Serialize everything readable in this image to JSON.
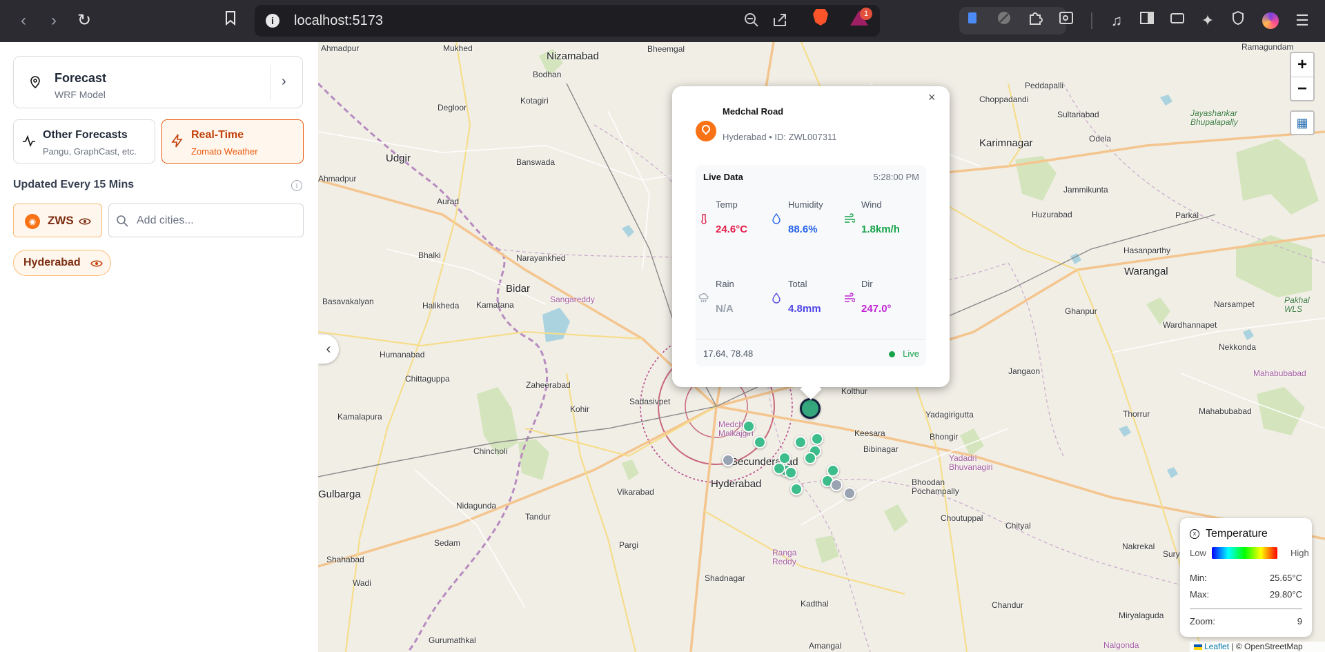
{
  "browser": {
    "url": "localhost:5173",
    "notification_count": "1"
  },
  "sidebar": {
    "forecast_card": {
      "title": "Forecast",
      "subtitle": "WRF Model"
    },
    "other_forecasts": {
      "title": "Other Forecasts",
      "subtitle": "Pangu, GraphCast, etc."
    },
    "realtime": {
      "title": "Real-Time",
      "subtitle": "Zomato Weather"
    },
    "updated_text": "Updated Every 15 Mins",
    "zws_label": "ZWS",
    "city_placeholder": "Add cities...",
    "city_chip": "Hyderabad",
    "accent_color": "#ea580c"
  },
  "map": {
    "places": [
      "Ahmadpur",
      "Mukhed",
      "Nizamabad",
      "Bheemgal",
      "Bodhan",
      "Degloor",
      "Kotagiri",
      "Peddapalli",
      "Choppadandi",
      "Sultanabad",
      "Jayashankar Bhupalapally",
      "Udgir",
      "Banswada",
      "Karimnagar",
      "Odela",
      "Aurad",
      "Jammikunta",
      "Huzurabad",
      "Parkal",
      "Ahmadpur",
      "Bhalki",
      "Narayankhed",
      "Hasanparthy",
      "Warangal",
      "Bidar",
      "Basavakalyan",
      "Halikheda",
      "Kamatana",
      "Sangareddy",
      "Narsampet",
      "Pakhal WLS",
      "Ghanpur",
      "Wardhannapet",
      "Nekkonda",
      "Humanabad",
      "Jangaon",
      "Mahabubabad",
      "Chittaguppa",
      "Zaheerabad",
      "Sadasivpet",
      "Kolthur",
      "Kohir",
      "Kamalapura",
      "Yadagirigutta",
      "Thorrur",
      "Mahabubabad",
      "Medchal-Malkajgiri",
      "Keesara",
      "Bhongir",
      "Bibinagar",
      "Chincholi",
      "Secunderabad",
      "Yadadri Bhuvanagiri",
      "Hyderabad",
      "Bhoodan Pochampally",
      "Vikarabad",
      "Nidagunda",
      "Tandur",
      "Choutuppal",
      "Chityal",
      "Sedam",
      "Pargi",
      "Nakrekal",
      "Suryapet",
      "Shahabad",
      "Ranga Reddy",
      "Wadi",
      "Shadnagar",
      "Kadthal",
      "Chandur",
      "Miryalaguda",
      "Gurumathkal",
      "Amangal",
      "Nalgonda",
      "Gulbarga",
      "Jayashankar Bhupalapally",
      "Udgir",
      "Ramagundam"
    ],
    "zoom_in": "+",
    "zoom_out": "−"
  },
  "popup": {
    "station_name": "Medchal Road",
    "station_sub": "Hyderabad • ID: ZWL007311",
    "live_label": "Live Data",
    "time": "5:28:00 PM",
    "temp_label": "Temp",
    "temp_value": "24.6°C",
    "humidity_label": "Humidity",
    "humidity_value": "88.6%",
    "wind_label": "Wind",
    "wind_value": "1.8km/h",
    "rain_label": "Rain",
    "rain_value": "N/A",
    "total_label": "Total",
    "total_value": "4.8mm",
    "dir_label": "Dir",
    "dir_value": "247.0°",
    "coords": "17.64, 78.48",
    "status": "Live",
    "colors": {
      "temp": "#e11d48",
      "humidity": "#2563eb",
      "wind": "#16a34a",
      "rain": "#9ca3af",
      "total": "#4f46e5",
      "dir": "#c026d3"
    }
  },
  "legend": {
    "title": "Temperature",
    "low": "Low",
    "high": "High",
    "min_label": "Min:",
    "min_value": "25.65°C",
    "max_label": "Max:",
    "max_value": "29.80°C",
    "zoom_label": "Zoom:",
    "zoom_value": "9"
  },
  "attribution": {
    "leaflet": "Leaflet",
    "osm": "| © OpenStreetMap"
  }
}
